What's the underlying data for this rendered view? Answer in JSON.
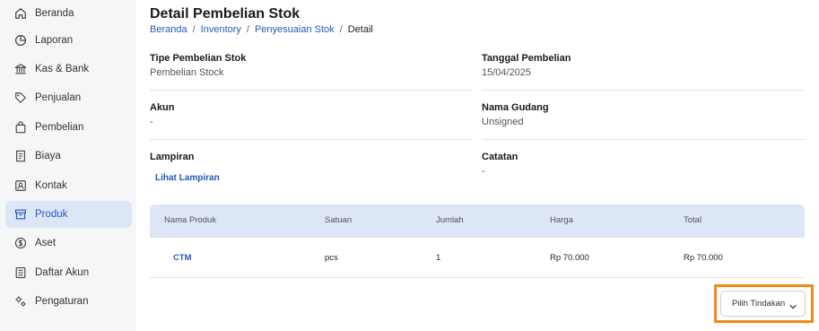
{
  "sidebar": {
    "items": [
      {
        "label": "Beranda",
        "icon": "home-icon",
        "active": false
      },
      {
        "label": "Laporan",
        "icon": "pie-chart-icon",
        "active": false
      },
      {
        "label": "Kas & Bank",
        "icon": "bank-icon",
        "active": false
      },
      {
        "label": "Penjualan",
        "icon": "tag-icon",
        "active": false
      },
      {
        "label": "Pembelian",
        "icon": "shopping-bag-icon",
        "active": false
      },
      {
        "label": "Biaya",
        "icon": "receipt-icon",
        "active": false
      },
      {
        "label": "Kontak",
        "icon": "contact-icon",
        "active": false
      },
      {
        "label": "Produk",
        "icon": "archive-box-icon",
        "active": true
      },
      {
        "label": "Aset",
        "icon": "dollar-circle-icon",
        "active": false
      },
      {
        "label": "Daftar Akun",
        "icon": "ledger-list-icon",
        "active": false
      },
      {
        "label": "Pengaturan",
        "icon": "gears-icon",
        "active": false
      }
    ],
    "active_color": "#2458b8",
    "active_bg": "#dde6f7"
  },
  "page": {
    "title": "Detail Pembelian Stok",
    "breadcrumb": {
      "links": [
        "Beranda",
        "Inventory",
        "Penyesuaian Stok"
      ],
      "separator": "/",
      "current": "Detail"
    }
  },
  "details": {
    "tipe": {
      "label": "Tipe Pembelian Stok",
      "value": "Pembelian Stock"
    },
    "tanggal": {
      "label": "Tanggal Pembelian",
      "value": "15/04/2025"
    },
    "akun": {
      "label": "Akun",
      "value": "-"
    },
    "gudang": {
      "label": "Nama Gudang",
      "value": "Unsigned"
    },
    "lampiran": {
      "label": "Lampiran",
      "link": "Lihat Lampiran"
    },
    "catatan": {
      "label": "Catatan",
      "value": "-"
    }
  },
  "table": {
    "columns": [
      "Nama Produk",
      "Satuan",
      "Jumlah",
      "Harga",
      "Total"
    ],
    "rows": [
      {
        "nama": "CTM",
        "satuan": "pcs",
        "jumlah": "1",
        "harga": "Rp 70.000",
        "total": "Rp 70.000"
      }
    ],
    "header_bg": "#dce6f7"
  },
  "actions": {
    "primary_label": "Pilih Tindakan",
    "highlight_color": "#f28a1b"
  }
}
